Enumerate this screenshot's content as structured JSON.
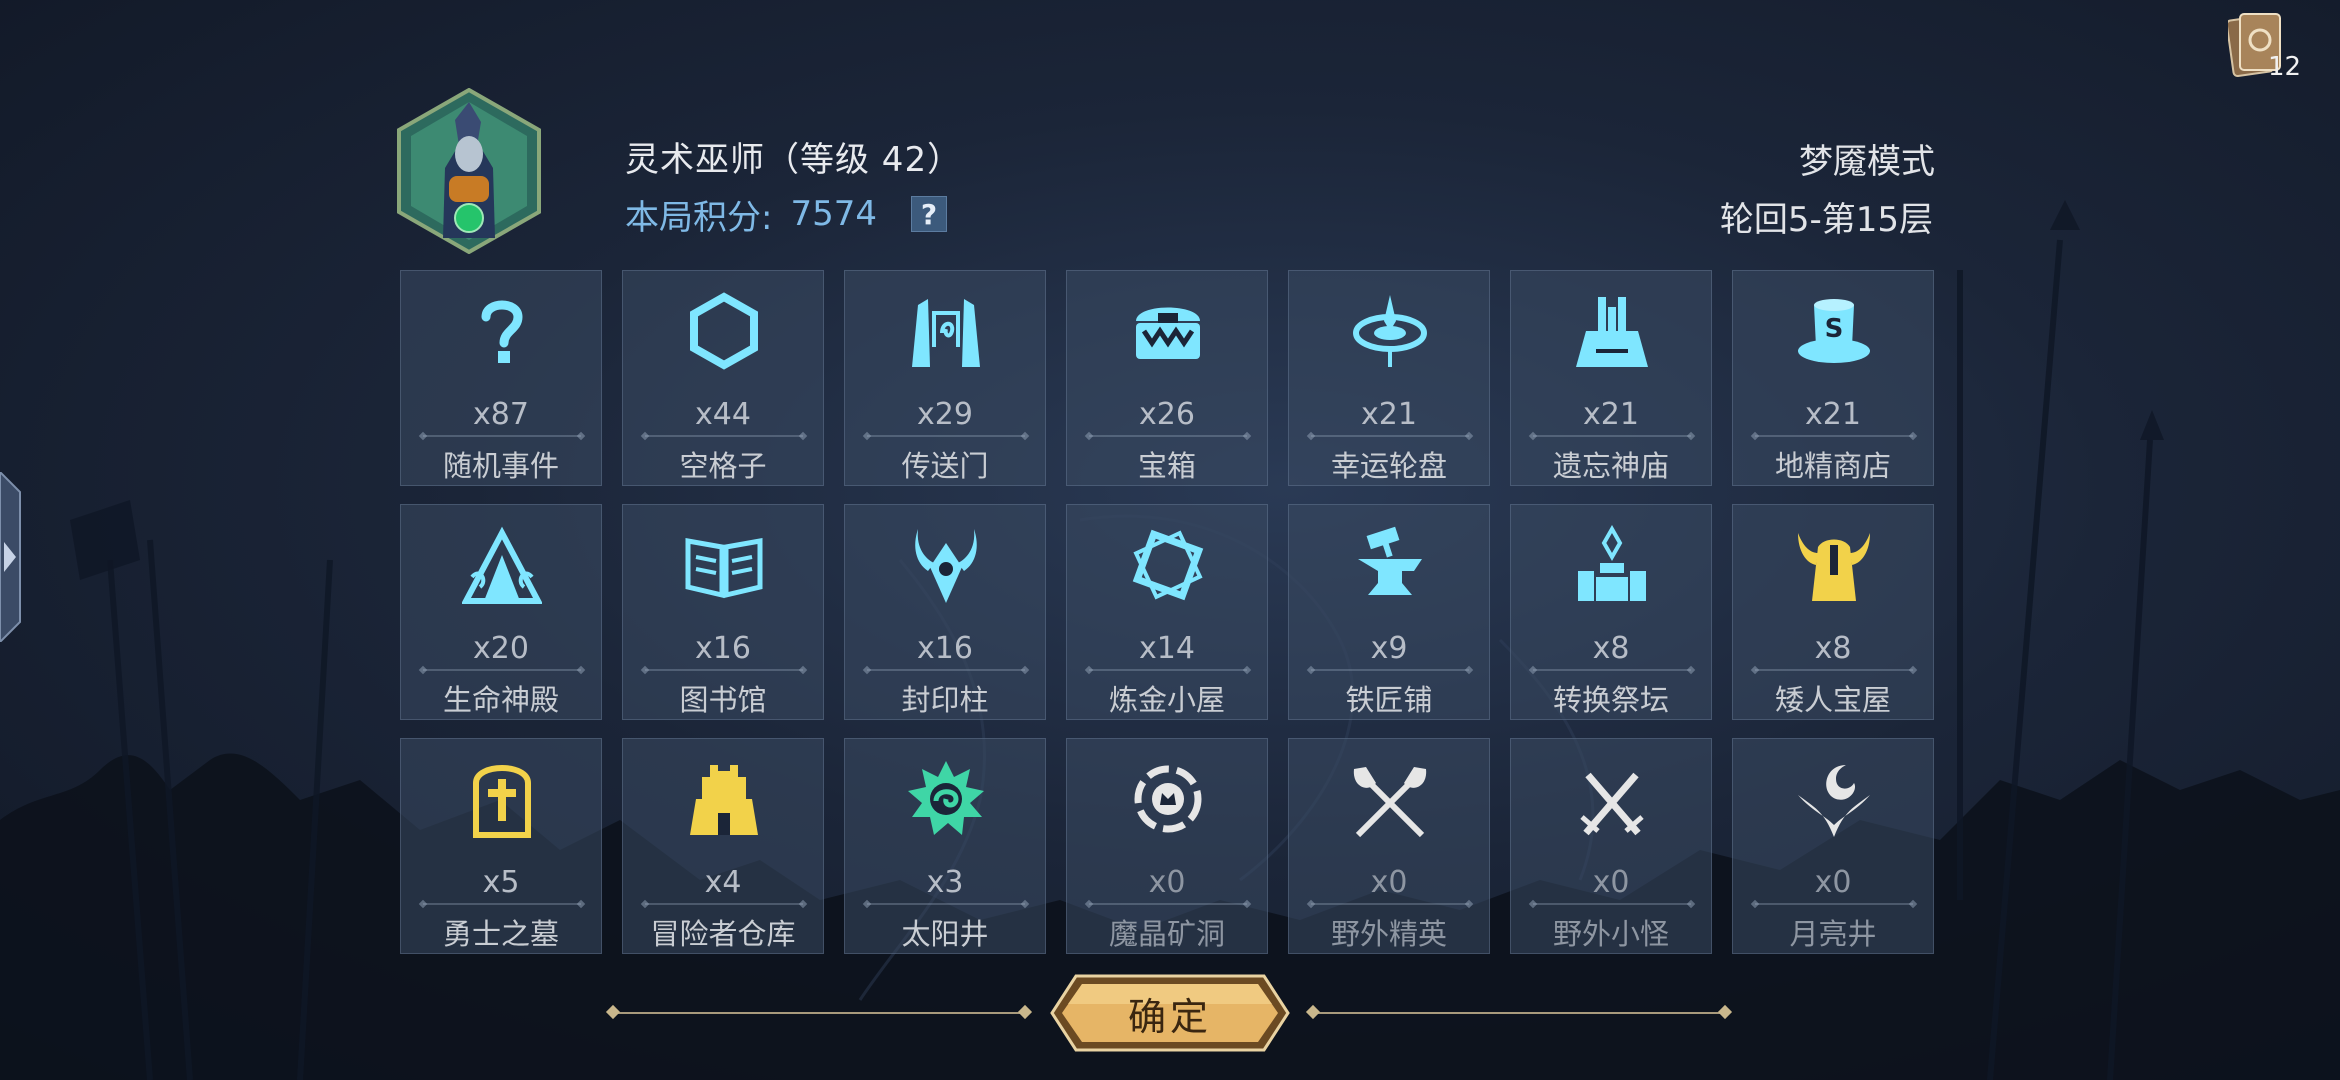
{
  "hero": {
    "name": "灵术巫师（等级 42）",
    "score_label": "本局积分:",
    "score_value": "7574",
    "help": "?"
  },
  "mode": {
    "name": "梦魇模式",
    "floor": "轮回5-第15层"
  },
  "deck": {
    "count": "12"
  },
  "tiles": [
    {
      "icon": "question-icon",
      "count": "x87",
      "name": "随机事件",
      "color": "#7fe6ff"
    },
    {
      "icon": "hexagon-icon",
      "count": "x44",
      "name": "空格子",
      "color": "#7fe6ff"
    },
    {
      "icon": "portal-icon",
      "count": "x29",
      "name": "传送门",
      "color": "#7fe6ff"
    },
    {
      "icon": "chest-icon",
      "count": "x26",
      "name": "宝箱",
      "color": "#7fe6ff"
    },
    {
      "icon": "wheel-icon",
      "count": "x21",
      "name": "幸运轮盘",
      "color": "#7fe6ff"
    },
    {
      "icon": "temple-icon",
      "count": "x21",
      "name": "遗忘神庙",
      "color": "#7fe6ff"
    },
    {
      "icon": "shop-icon",
      "count": "x21",
      "name": "地精商店",
      "color": "#7fe6ff"
    },
    {
      "icon": "life-temple-icon",
      "count": "x20",
      "name": "生命神殿",
      "color": "#7fe6ff"
    },
    {
      "icon": "library-icon",
      "count": "x16",
      "name": "图书馆",
      "color": "#7fe6ff"
    },
    {
      "icon": "seal-pillar-icon",
      "count": "x16",
      "name": "封印柱",
      "color": "#7fe6ff"
    },
    {
      "icon": "alchemy-icon",
      "count": "x14",
      "name": "炼金小屋",
      "color": "#7fe6ff"
    },
    {
      "icon": "anvil-icon",
      "count": "x9",
      "name": "铁匠铺",
      "color": "#7fe6ff"
    },
    {
      "icon": "altar-icon",
      "count": "x8",
      "name": "转换祭坛",
      "color": "#7fe6ff"
    },
    {
      "icon": "dwarf-treasure-icon",
      "count": "x8",
      "name": "矮人宝屋",
      "color": "#f2d24a"
    },
    {
      "icon": "tomb-icon",
      "count": "x5",
      "name": "勇士之墓",
      "color": "#f2d24a"
    },
    {
      "icon": "warehouse-icon",
      "count": "x4",
      "name": "冒险者仓库",
      "color": "#f2d24a"
    },
    {
      "icon": "sun-well-icon",
      "count": "x3",
      "name": "太阳井",
      "color": "#3fd6a6"
    },
    {
      "icon": "crystal-mine-icon",
      "count": "x0",
      "name": "魔晶矿洞",
      "color": "#e6e6e6"
    },
    {
      "icon": "elite-axes-icon",
      "count": "x0",
      "name": "野外精英",
      "color": "#e6e6e6"
    },
    {
      "icon": "swords-icon",
      "count": "x0",
      "name": "野外小怪",
      "color": "#e6e6e6"
    },
    {
      "icon": "moon-well-icon",
      "count": "x0",
      "name": "月亮井",
      "color": "#e6e6e6"
    }
  ],
  "confirm": {
    "label": "确定"
  }
}
